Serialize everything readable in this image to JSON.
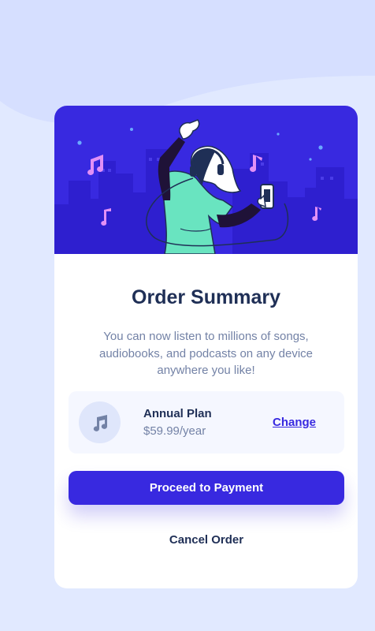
{
  "colors": {
    "page_background": "#e1e9ff",
    "wave": "#d3dcff",
    "hero_background": "#3829e0",
    "accent": "#3829e0",
    "card_background": "#ffffff",
    "plan_box_background": "#f5f7ff",
    "heading_text": "#1f2f56",
    "muted_text": "#7382a6"
  },
  "hero": {
    "illustration": "person-dancing-with-headphones-illustration",
    "icons": [
      "music-note-icon",
      "city-skyline"
    ]
  },
  "summary": {
    "title": "Order Summary",
    "description": "You can now listen to millions of songs, audiobooks, and podcasts on any device anywhere you like!"
  },
  "plan": {
    "icon": "music-note-icon",
    "name": "Annual Plan",
    "price": "$59.99/year",
    "change_label": "Change"
  },
  "actions": {
    "proceed_label": "Proceed to Payment",
    "cancel_label": "Cancel Order"
  }
}
